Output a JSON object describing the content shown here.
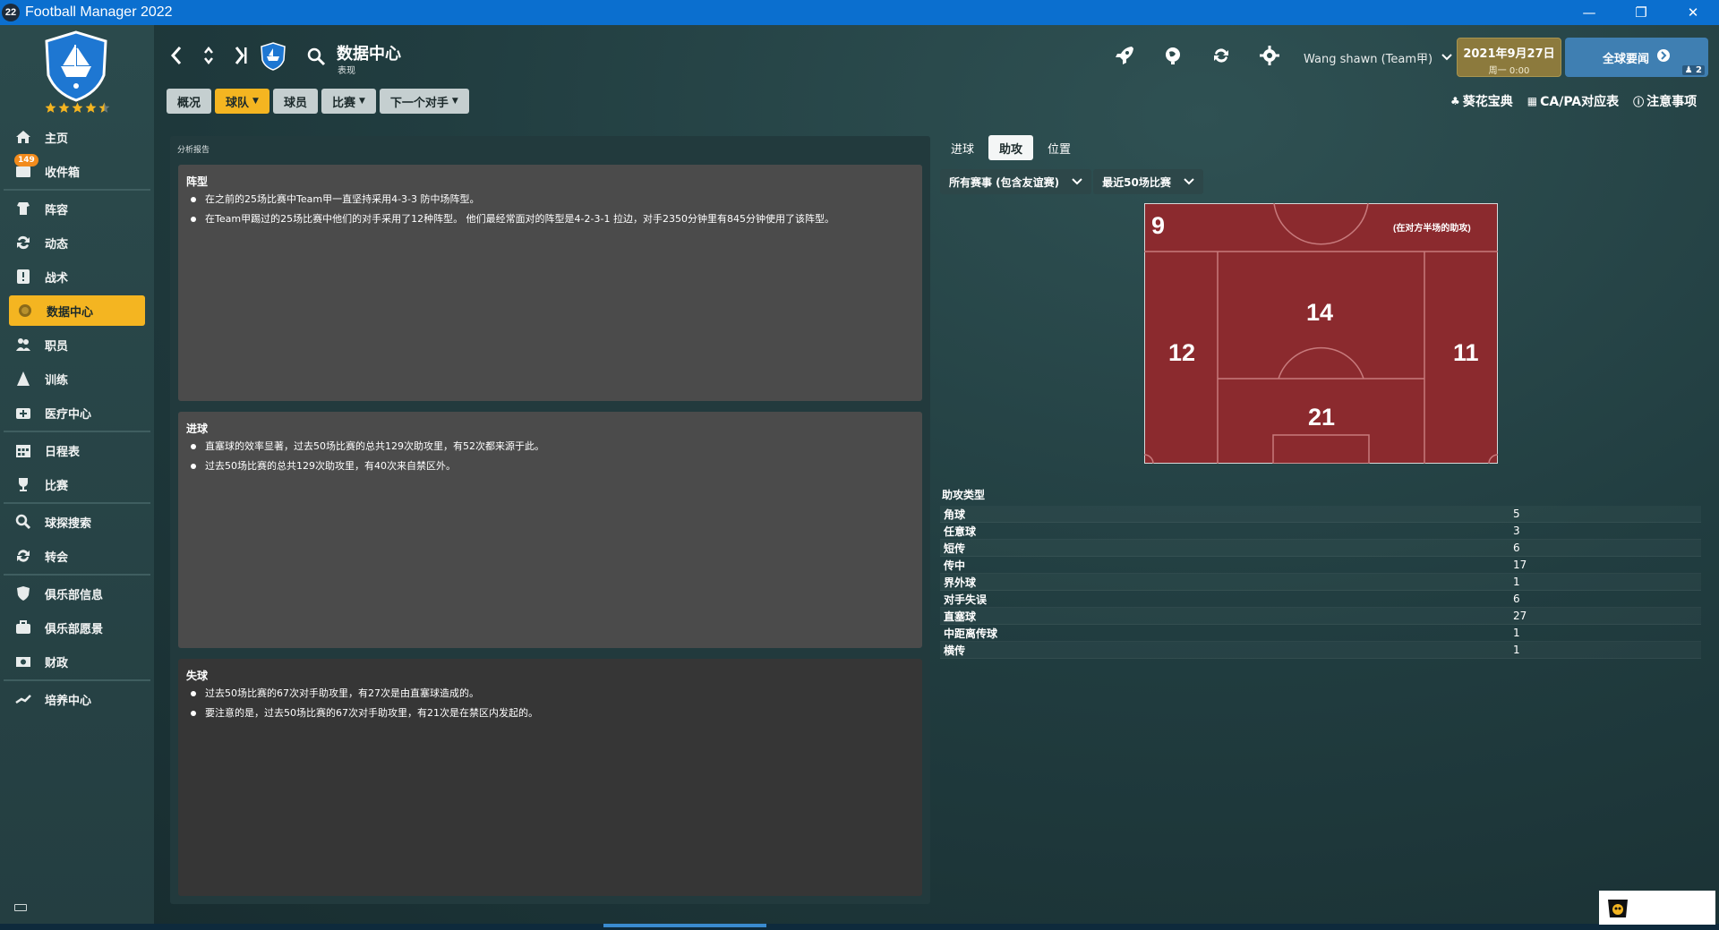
{
  "window": {
    "app_icon": "22",
    "title": "Football Manager 2022"
  },
  "sidebar": {
    "items": [
      {
        "label": "主页",
        "icon": "home-icon"
      },
      {
        "label": "收件箱",
        "icon": "inbox-icon",
        "badge": "149"
      },
      {
        "label": "阵容",
        "icon": "squad-icon"
      },
      {
        "label": "动态",
        "icon": "dynamics-icon"
      },
      {
        "label": "战术",
        "icon": "tactics-icon"
      },
      {
        "label": "数据中心",
        "icon": "data-hub-icon",
        "active": true
      },
      {
        "label": "职员",
        "icon": "staff-icon"
      },
      {
        "label": "训练",
        "icon": "training-icon"
      },
      {
        "label": "医疗中心",
        "icon": "medical-icon"
      },
      {
        "label": "日程表",
        "icon": "calendar-icon"
      },
      {
        "label": "比赛",
        "icon": "trophy-icon"
      },
      {
        "label": "球探搜索",
        "icon": "scouting-icon"
      },
      {
        "label": "转会",
        "icon": "transfer-icon"
      },
      {
        "label": "俱乐部信息",
        "icon": "club-info-icon"
      },
      {
        "label": "俱乐部愿景",
        "icon": "club-vision-icon"
      },
      {
        "label": "财政",
        "icon": "finance-icon"
      },
      {
        "label": "培养中心",
        "icon": "development-icon"
      }
    ]
  },
  "header": {
    "title": "数据中心",
    "subtitle": "表现",
    "tabs": [
      {
        "label": "概况",
        "dropdown": false
      },
      {
        "label": "球队",
        "dropdown": true,
        "active": true
      },
      {
        "label": "球员",
        "dropdown": false
      },
      {
        "label": "比赛",
        "dropdown": true
      },
      {
        "label": "下一个对手",
        "dropdown": true
      }
    ],
    "manager_name": "Wang shawn (Team甲)",
    "date_main": "2021年9月27日",
    "date_sub": "周一 0:00",
    "news_button": "全球要闻",
    "news_count": "2",
    "quick_links": [
      "葵花宝典",
      "CA/PA对应表",
      "注意事项"
    ]
  },
  "analysis": {
    "label": "分析报告",
    "sections": [
      {
        "title": "阵型",
        "bullets": [
          "在之前的25场比赛中Team甲一直坚持采用4-3-3 防中场阵型。",
          "在Team甲踢过的25场比赛中他们的对手采用了12种阵型。 他们最经常面对的阵型是4-2-3-1 拉边，对手2350分钟里有845分钟使用了该阵型。"
        ]
      },
      {
        "title": "进球",
        "bullets": [
          "直塞球的效率显著，过去50场比赛的总共129次助攻里，有52次都来源于此。",
          "过去50场比赛的总共129次助攻里，有40次来自禁区外。"
        ]
      },
      {
        "title": "失球",
        "bullets": [
          "过去50场比赛的67次对手助攻里，有27次是由直塞球造成的。",
          "要注意的是，过去50场比赛的67次对手助攻里，有21次是在禁区内发起的。"
        ]
      }
    ]
  },
  "right_panel": {
    "tabs": [
      "进球",
      "助攻",
      "位置"
    ],
    "active_tab": "助攻",
    "filters": [
      "所有赛事 (包含友谊赛)",
      "最近50场比赛"
    ],
    "pitch": {
      "opponent_half": "9",
      "opponent_half_note": "(在对方半场的助攻)",
      "left_wing": "12",
      "center_top": "14",
      "right_wing": "11",
      "center_bottom": "21",
      "fill_color": "#8b2a2e",
      "line_color": "#c77a7c"
    },
    "types_title": "助攻类型",
    "types": [
      {
        "name": "角球",
        "value": "5"
      },
      {
        "name": "任意球",
        "value": "3"
      },
      {
        "name": "短传",
        "value": "6"
      },
      {
        "name": "传中",
        "value": "17"
      },
      {
        "name": "界外球",
        "value": "1"
      },
      {
        "name": "对手失误",
        "value": "6"
      },
      {
        "name": "直塞球",
        "value": "27"
      },
      {
        "name": "中距离传球",
        "value": "1"
      },
      {
        "name": "横传",
        "value": "1"
      }
    ]
  },
  "colors": {
    "accent": "#f4b521",
    "titlebar": "#0b6fcf",
    "news_button": "#3f7fb2",
    "date_box": "#8c7a3d"
  }
}
